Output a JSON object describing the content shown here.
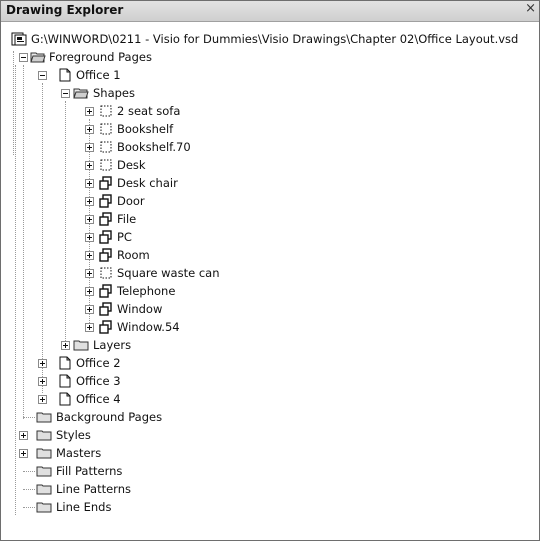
{
  "window": {
    "title": "Drawing Explorer",
    "close": "×"
  },
  "tree": {
    "root": "G:\\WINWORD\\0211 - Visio for Dummies\\Visio Drawings\\Chapter 02\\Office Layout.vsd",
    "foreground_pages": "Foreground Pages",
    "office1": "Office 1",
    "shapes": "Shapes",
    "shape_items": [
      "2 seat sofa",
      "Bookshelf",
      "Bookshelf.70",
      "Desk",
      "Desk chair",
      "Door",
      "File",
      "PC",
      "Room",
      "Square waste can",
      "Telephone",
      "Window",
      "Window.54"
    ],
    "layers": "Layers",
    "office2": "Office 2",
    "office3": "Office 3",
    "office4": "Office 4",
    "background_pages": "Background Pages",
    "styles": "Styles",
    "masters": "Masters",
    "fill_patterns": "Fill Patterns",
    "line_patterns": "Line Patterns",
    "line_ends": "Line Ends"
  }
}
